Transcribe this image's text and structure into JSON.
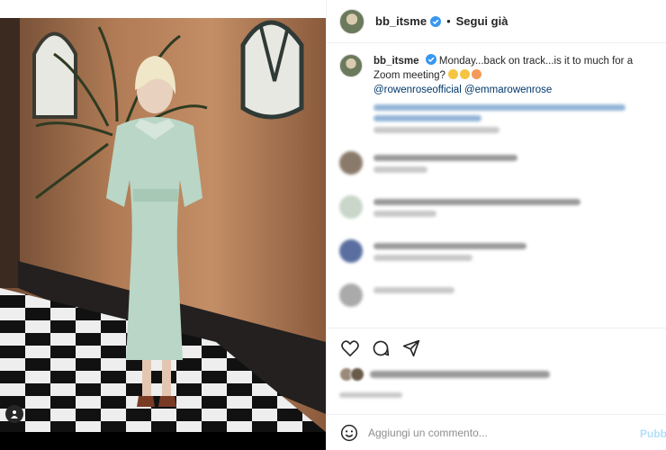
{
  "post": {
    "username": "bb_itsme",
    "follow_label": "Segui già",
    "separator": "•"
  },
  "caption": {
    "username": "bb_itsme",
    "text": "Monday...back on track...is it to much for a Zoom meeting?",
    "mentions": [
      "@rowenroseofficial",
      "@emmarowenrose"
    ]
  },
  "add_comment": {
    "placeholder": "Aggiungi un commento...",
    "publish_label": "Pubblica"
  },
  "icons": {
    "verified": "verified-badge-icon",
    "like": "heart-icon",
    "comment": "comment-icon",
    "share": "paper-plane-icon",
    "emoji": "smiley-icon",
    "user_tag": "user-tag-icon"
  },
  "colors": {
    "verified": "#3897f0",
    "mention": "#00376b",
    "publish": "#b2dffc"
  }
}
